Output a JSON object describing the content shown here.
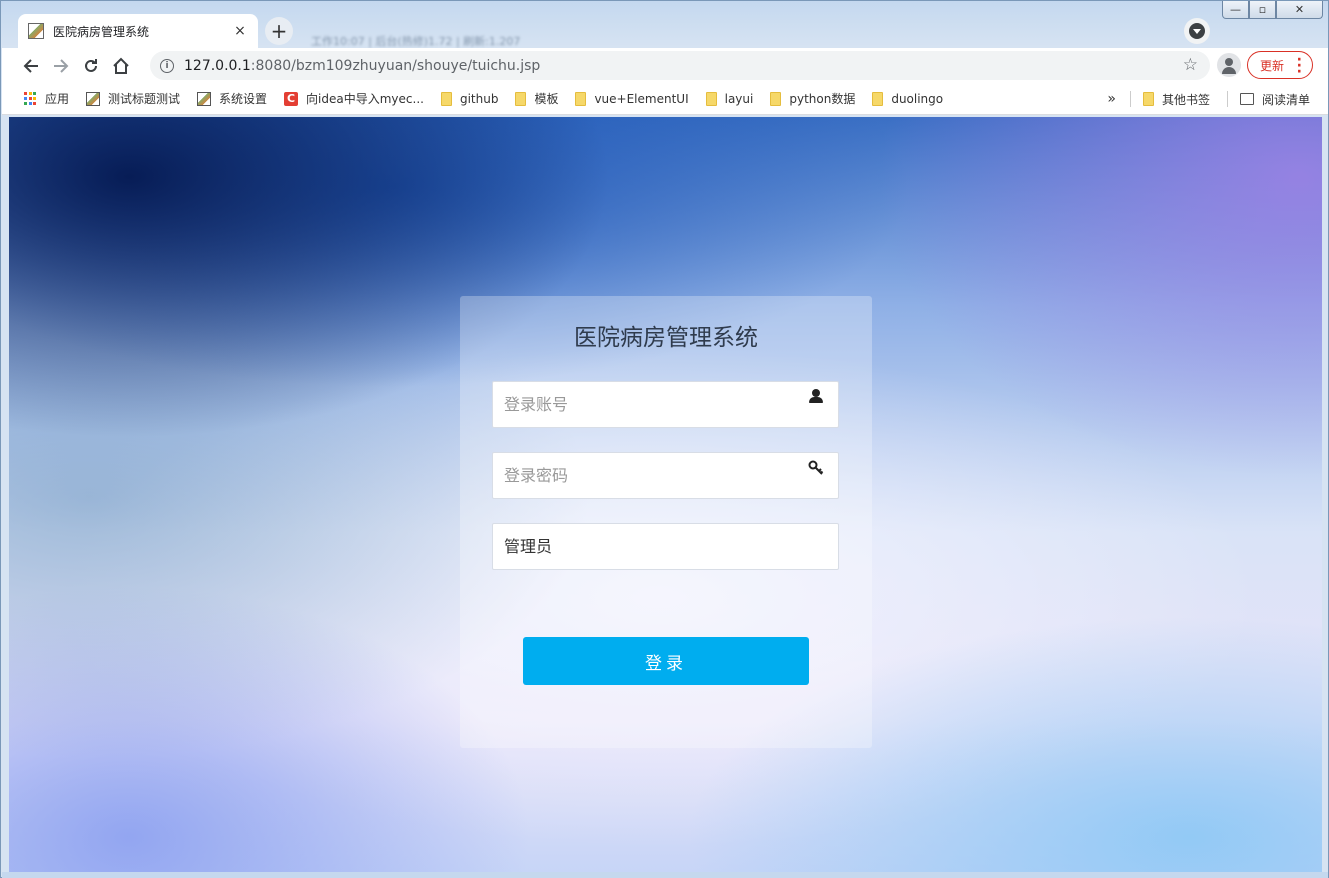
{
  "browser": {
    "tab": {
      "title": "医院病房管理系统",
      "close_label": "×"
    },
    "new_tab_label": "+",
    "blurred_tabs_text": "工作10:07 | 后台(热修)1.72 | 刷新:1.207",
    "window_controls": {
      "minimize": "—",
      "maximize": "▫",
      "close": "✕"
    },
    "address": {
      "host": "127.0.0.1",
      "path": ":8080/bzm109zhuyuan/shouye/tuichu.jsp"
    },
    "update_button_label": "更新",
    "bookmarks": [
      {
        "label": "应用",
        "icon": "apps-grid-icon"
      },
      {
        "label": "测试标题测试",
        "icon": "page-image-icon"
      },
      {
        "label": "系统设置",
        "icon": "page-image-icon"
      },
      {
        "label": "向idea中导入myec...",
        "icon": "csdn-icon"
      },
      {
        "label": "github",
        "icon": "folder-icon"
      },
      {
        "label": "模板",
        "icon": "folder-icon"
      },
      {
        "label": "vue+ElementUI",
        "icon": "folder-icon"
      },
      {
        "label": "layui",
        "icon": "folder-icon"
      },
      {
        "label": "python数据",
        "icon": "folder-icon"
      },
      {
        "label": "duolingo",
        "icon": "folder-icon"
      }
    ],
    "bookmarks_overflow_label": "»",
    "other_bookmarks_label": "其他书签",
    "reading_list_label": "阅读清单"
  },
  "login": {
    "title": "医院病房管理系统",
    "username_placeholder": "登录账号",
    "password_placeholder": "登录密码",
    "role_value": "管理员",
    "submit_label": "登录"
  },
  "colors": {
    "login_button": "#00adef",
    "update_button": "#d93025"
  }
}
